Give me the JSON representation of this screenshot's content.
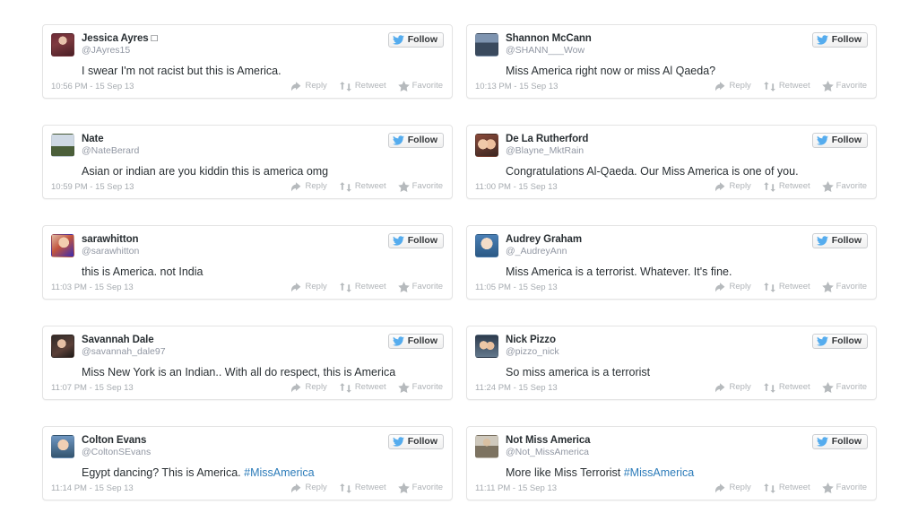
{
  "page": {
    "title": "Miss America 2013 racist tweets collage",
    "background_color": "#ffffff",
    "card_border_color": "#e4e4e4",
    "hashtag_color": "#2b7bb9",
    "follow_label": "Follow"
  },
  "actions": {
    "reply": "Reply",
    "retweet": "Retweet",
    "favorite": "Favorite"
  },
  "tweets": [
    {
      "name": "Jessica Ayres □",
      "handle": "@JAyres15",
      "text": "I swear I'm not racist but this is America.",
      "hashtag": "",
      "timestamp": "10:56 PM - 15 Sep 13",
      "avatar_class": "av-jessica"
    },
    {
      "name": "Shannon McCann",
      "handle": "@SHANN___Wow",
      "text": "Miss America right now or miss Al Qaeda?",
      "hashtag": "",
      "timestamp": "10:13 PM - 15 Sep 13",
      "avatar_class": "av-shannon"
    },
    {
      "name": "Nate",
      "handle": "@NateBerard",
      "text": "Asian or indian are you kiddin this is america omg",
      "hashtag": "",
      "timestamp": "10:59 PM - 15 Sep 13",
      "avatar_class": "av-nate"
    },
    {
      "name": "De La Rutherford",
      "handle": "@Blayne_MktRain",
      "text": "Congratulations Al-Qaeda. Our Miss America is one of you.",
      "hashtag": "",
      "timestamp": "11:00 PM - 15 Sep 13",
      "avatar_class": "av-delarutherford"
    },
    {
      "name": "sarawhitton",
      "handle": "@sarawhitton",
      "text": "this is America. not India",
      "hashtag": "",
      "timestamp": "11:03 PM - 15 Sep 13",
      "avatar_class": "av-sarawhitton"
    },
    {
      "name": "Audrey Graham",
      "handle": "@_AudreyAnn",
      "text": "Miss America is a terrorist. Whatever. It's fine.",
      "hashtag": "",
      "timestamp": "11:05 PM - 15 Sep 13",
      "avatar_class": "av-audrey"
    },
    {
      "name": "Savannah Dale",
      "handle": "@savannah_dale97",
      "text": "Miss New York is an Indian.. With all do respect, this is America",
      "hashtag": "",
      "timestamp": "11:07 PM - 15 Sep 13",
      "avatar_class": "av-savannah"
    },
    {
      "name": "Nick Pizzo",
      "handle": "@pizzo_nick",
      "text": "So miss america is a terrorist",
      "hashtag": "",
      "timestamp": "11:24 PM - 15 Sep 13",
      "avatar_class": "av-nickpizzo"
    },
    {
      "name": "Colton Evans",
      "handle": "@ColtonSEvans",
      "text": "Egypt dancing? This is America. ",
      "hashtag": "#MissAmerica",
      "timestamp": "11:14 PM - 15 Sep 13",
      "avatar_class": "av-colton"
    },
    {
      "name": "Not Miss America",
      "handle": "@Not_MissAmerica",
      "text": "More like Miss Terrorist ",
      "hashtag": "#MissAmerica",
      "timestamp": "11:11 PM - 15 Sep 13",
      "avatar_class": "av-notmiss"
    }
  ]
}
